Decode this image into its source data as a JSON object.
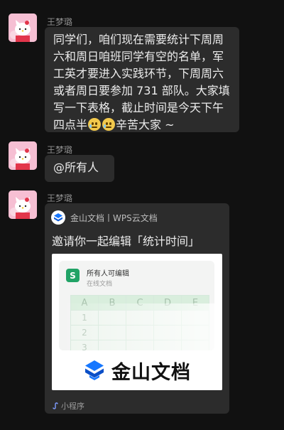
{
  "messages": [
    {
      "sender": "王梦璐",
      "lines": [
        "同学们，咱们现在需要统计下周周",
        "六和周日咱班同学有空的名单，军",
        "工英才要进入实践环节，下周周六",
        "或者周日要参加 731 部队。大家填",
        "写一下表格，截止时间是今天下午"
      ],
      "last_line_prefix": "四点半",
      "emoji_1": "crying-emoji",
      "emoji_2": "crying-emoji",
      "last_line_suffix": "辛苦大家 ~"
    },
    {
      "sender": "王梦璐",
      "text": "@所有人"
    },
    {
      "sender": "王梦璐",
      "card": {
        "source": "金山文档丨WPS云文档",
        "title": "邀请你一起编辑「统计时间」",
        "doc_name": "所有人可编辑",
        "doc_sub": "在线文档",
        "doc_icon_letter": "S",
        "columns": [
          "A",
          "B",
          "C",
          "D",
          "E"
        ],
        "rows": [
          "1",
          "2",
          "3"
        ],
        "brand": "金山文档",
        "footer": "小程序"
      }
    }
  ],
  "colors": {
    "background": "#111111",
    "bubble": "#2c2c2c",
    "sender_text": "#8d8d8d",
    "sheet_green": "#21a366",
    "brand_blue": "#1677ff"
  }
}
